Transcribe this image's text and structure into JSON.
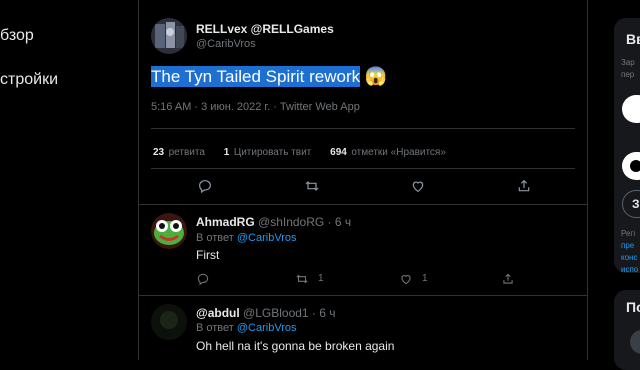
{
  "nav": {
    "explore_label": "бзор",
    "settings_label": "стройки"
  },
  "tweet": {
    "display_name": "RELLvex @RELLGames",
    "handle": "@CaribVros",
    "text": "The Tyn Tailed Spirit rework",
    "emoji": "😱",
    "timestamp": "5:16 AM · 3 июн. 2022 г. · Twitter Web App",
    "retweets_count": "23",
    "retweets_label": "ретвита",
    "quotes_count": "1",
    "quotes_label": "Цитировать твит",
    "likes_count": "694",
    "likes_label": "отметки «Нравится»"
  },
  "replies": [
    {
      "display_name": "AhmadRG",
      "handle": "@shIndoRG · 6 ч",
      "reply_to_prefix": "В ответ",
      "reply_to_handle": "@CaribVros",
      "text": "First",
      "retweets": "1",
      "likes": "1"
    },
    {
      "display_name": "@abdul",
      "handle": "@LGBlood1 · 6 ч",
      "reply_to_prefix": "В ответ",
      "reply_to_handle": "@CaribVros",
      "text": "Oh hell na it's gonna be broken again"
    }
  ],
  "sidebar": {
    "card1_title": "Вв",
    "card1_line1": "Зар",
    "card1_line2": "пер",
    "option3_label": "З",
    "info_line1": "Регі",
    "info_link1": "пре",
    "info_link2": "конс",
    "info_link3": "испо",
    "card2_title": "По"
  },
  "colors": {
    "background": "#000000",
    "text": "#e7e9ea",
    "muted": "#71767b",
    "accent": "#1d9bf0",
    "selection": "#1d6fd1",
    "border": "#2f3336"
  }
}
